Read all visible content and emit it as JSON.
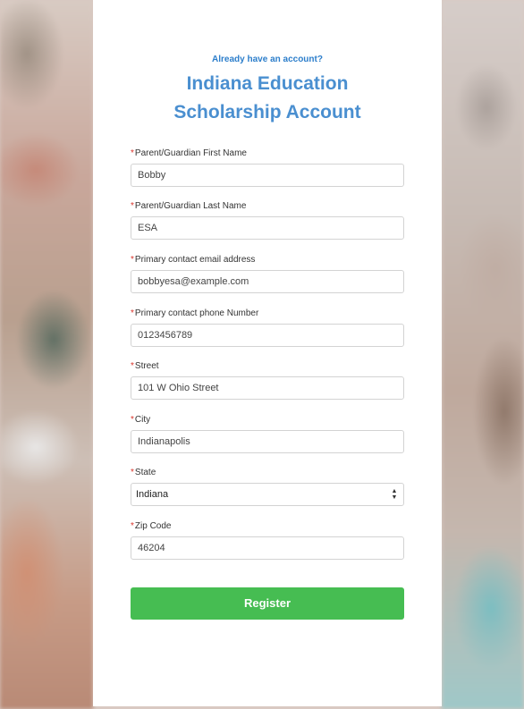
{
  "header": {
    "already_text": "Already have an account?",
    "title_line1": "Indiana Education",
    "title_line2": "Scholarship Account"
  },
  "form": {
    "required_marker": "*",
    "fields": [
      {
        "label": "Parent/Guardian First Name",
        "value": "Bobby"
      },
      {
        "label": "Parent/Guardian Last Name",
        "value": "ESA"
      },
      {
        "label": "Primary contact email address",
        "value": "bobbyesa@example.com"
      },
      {
        "label": "Primary contact phone Number",
        "value": "0123456789"
      },
      {
        "label": "Street",
        "value": "101 W Ohio Street"
      },
      {
        "label": "City",
        "value": "Indianapolis"
      },
      {
        "label": "State",
        "value": "Indiana"
      },
      {
        "label": "Zip Code",
        "value": "46204"
      }
    ],
    "register_label": "Register"
  },
  "colors": {
    "accent_blue": "#4a8fd0",
    "link_blue": "#2c7ecb",
    "register_green": "#46bd52",
    "required_red": "#d9342b"
  },
  "icons": {
    "state_select": "select-updown-arrows-icon"
  }
}
